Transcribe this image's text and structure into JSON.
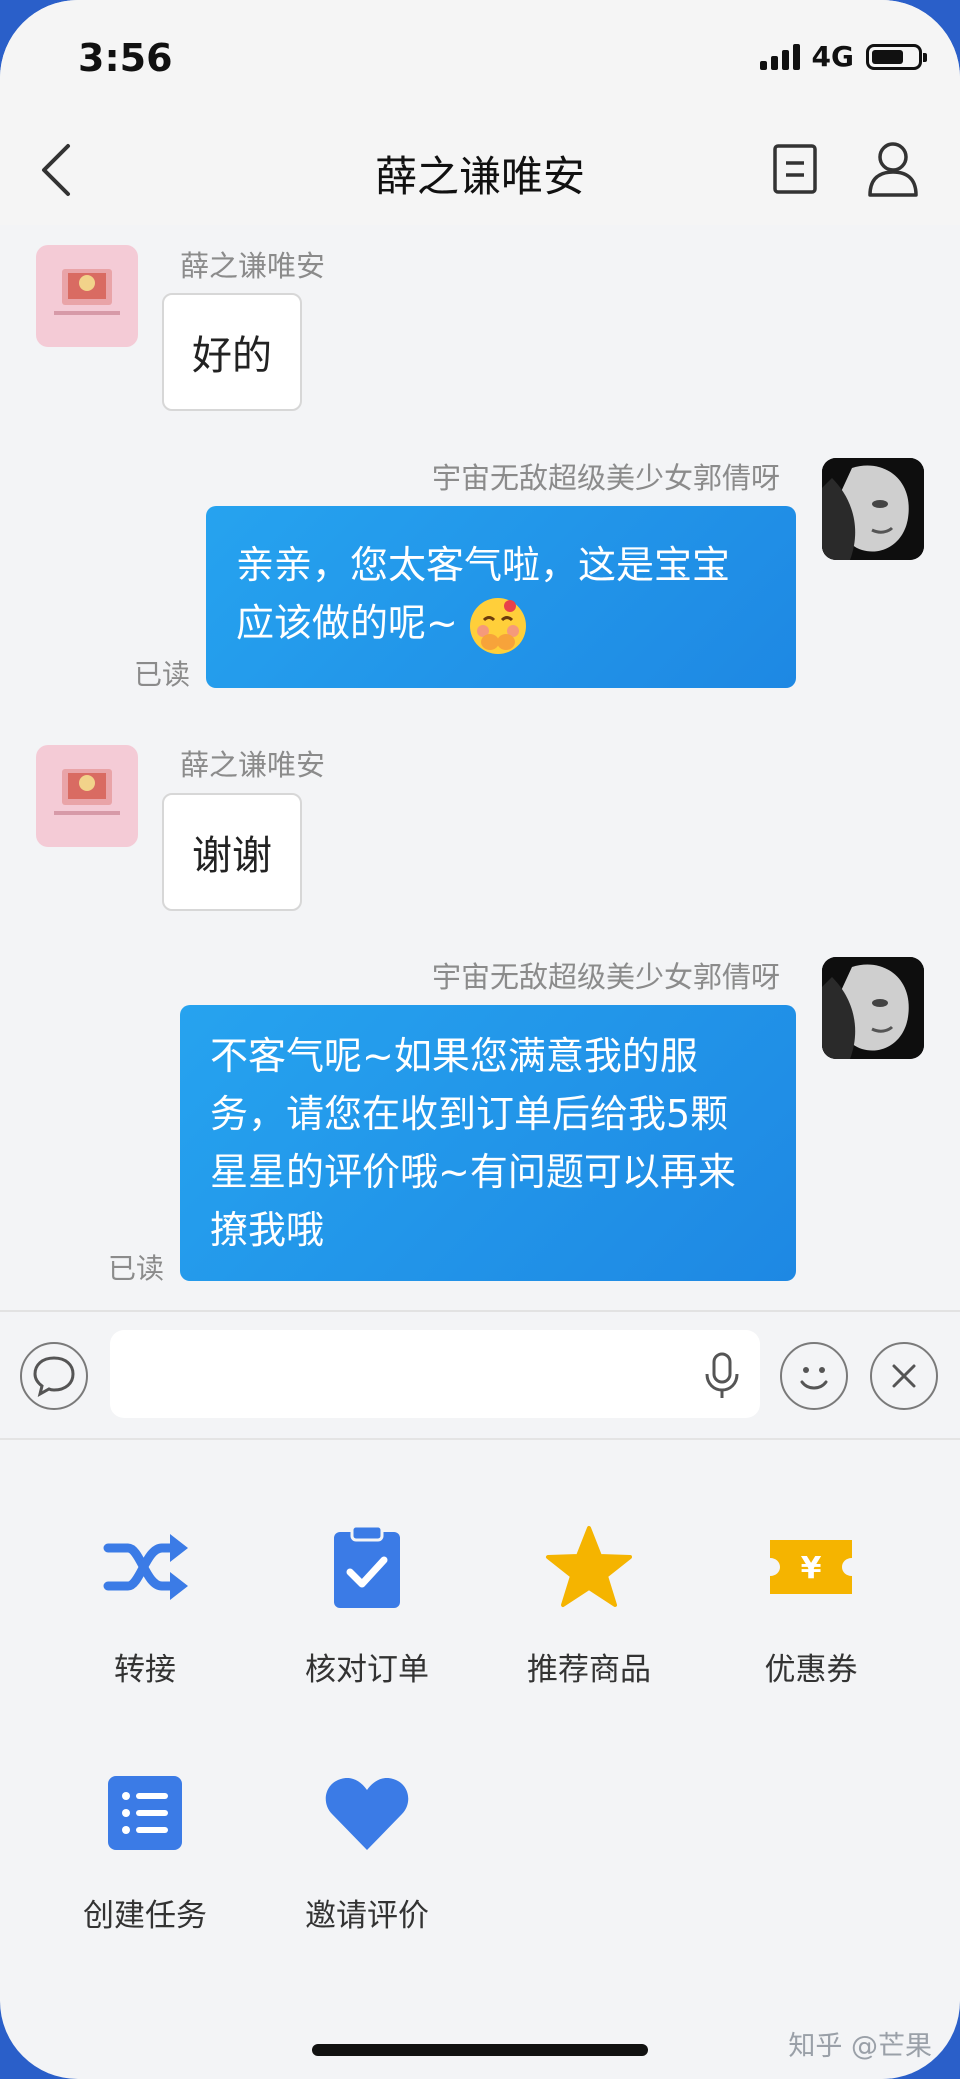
{
  "status_bar": {
    "time": "3:56",
    "network": "4G",
    "battery_level": 0.7
  },
  "nav": {
    "title": "薛之谦唯安"
  },
  "messages": [
    {
      "sender": "薛之谦唯安",
      "text": "好的"
    },
    {
      "sender": "宇宙无敌超级美少女郭倩呀",
      "text": "亲亲，您太客气啦，这是宝宝应该做的呢~",
      "status": "已读"
    },
    {
      "sender": "薛之谦唯安",
      "text": "谢谢"
    },
    {
      "sender": "宇宙无敌超级美少女郭倩呀",
      "text": "不客气呢~如果您满意我的服务，请您在收到订单后给我5颗星星的评价哦~有问题可以再来撩我哦",
      "status": "已读"
    }
  ],
  "tools": [
    {
      "label": "转接",
      "icon": "transfer-icon",
      "color": "#3b7be6"
    },
    {
      "label": "核对订单",
      "icon": "clipboard-check-icon",
      "color": "#3b7be6"
    },
    {
      "label": "推荐商品",
      "icon": "star-icon",
      "color": "#f5b400"
    },
    {
      "label": "优惠券",
      "icon": "coupon-icon",
      "color": "#f5b400"
    },
    {
      "label": "创建任务",
      "icon": "task-list-icon",
      "color": "#3b7be6"
    },
    {
      "label": "邀请评价",
      "icon": "heart-icon",
      "color": "#3b7be6"
    }
  ],
  "watermark": "知乎 @芒果"
}
